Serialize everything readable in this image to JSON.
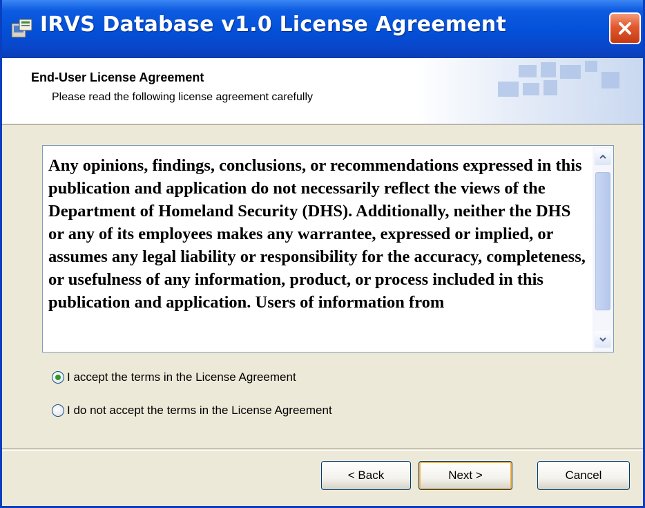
{
  "window": {
    "title": "IRVS Database v1.0 License Agreement"
  },
  "header": {
    "title": "End-User License Agreement",
    "subtitle": "Please read the following license agreement carefully"
  },
  "license": {
    "text": "Any opinions, findings, conclusions, or recommendations expressed in this publication and application do not necessarily reflect the views of the Department of Homeland Security (DHS).  Additionally, neither the DHS or any of its employees makes any warrantee, expressed or implied, or assumes any legal liability or responsibility for the accuracy, completeness, or usefulness of any information, product, or process included in this publication and application.  Users of information from"
  },
  "options": {
    "accept_label": "I accept the terms in the License Agreement",
    "decline_label": "I do not accept the terms in the License Agreement",
    "selected": "accept"
  },
  "buttons": {
    "back": "< Back",
    "next": "Next >",
    "cancel": "Cancel"
  },
  "icons": {
    "app": "installer-icon",
    "close": "close-icon",
    "scroll_up": "scroll-up-icon",
    "scroll_down": "scroll-down-icon"
  },
  "colors": {
    "titlebar": "#0350d8",
    "close": "#e2582e",
    "dialog_bg": "#ece9d8",
    "default_button_focus": "#f5b34a"
  }
}
